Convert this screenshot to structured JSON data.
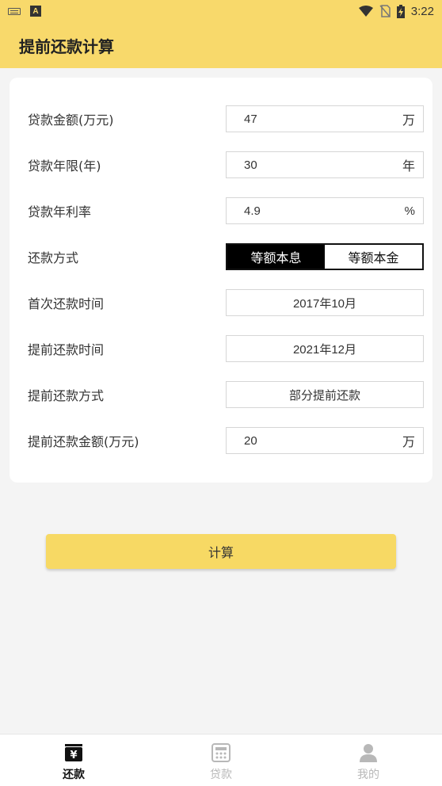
{
  "status_bar": {
    "time": "3:22",
    "left_icons": [
      "keyboard-icon",
      "a-icon"
    ],
    "right_icons": [
      "wifi-icon",
      "no-sim-icon",
      "battery-charging-icon"
    ],
    "a_letter": "A"
  },
  "header": {
    "title": "提前还款计算"
  },
  "form": {
    "loan_amount": {
      "label": "贷款金额(万元)",
      "value": "47",
      "unit": "万"
    },
    "loan_years": {
      "label": "贷款年限(年)",
      "value": "30",
      "unit": "年"
    },
    "annual_rate": {
      "label": "贷款年利率",
      "value": "4.9",
      "unit": "%"
    },
    "repay_method": {
      "label": "还款方式",
      "options": [
        "等额本息",
        "等额本金"
      ],
      "selected": "等额本息"
    },
    "first_repay_time": {
      "label": "首次还款时间",
      "value": "2017年10月"
    },
    "prepay_time": {
      "label": "提前还款时间",
      "value": "2021年12月"
    },
    "prepay_method": {
      "label": "提前还款方式",
      "value": "部分提前还款"
    },
    "prepay_amount": {
      "label": "提前还款金额(万元)",
      "value": "20",
      "unit": "万"
    }
  },
  "calculate_button": {
    "label": "计算"
  },
  "tabs": [
    {
      "label": "还款",
      "icon": "yuan-wallet-icon",
      "active": true
    },
    {
      "label": "贷款",
      "icon": "calculator-icon",
      "active": false
    },
    {
      "label": "我的",
      "icon": "person-icon",
      "active": false
    }
  ],
  "colors": {
    "accent": "#f8d96b",
    "button": "#f7d964",
    "background": "#f4f4f4"
  }
}
